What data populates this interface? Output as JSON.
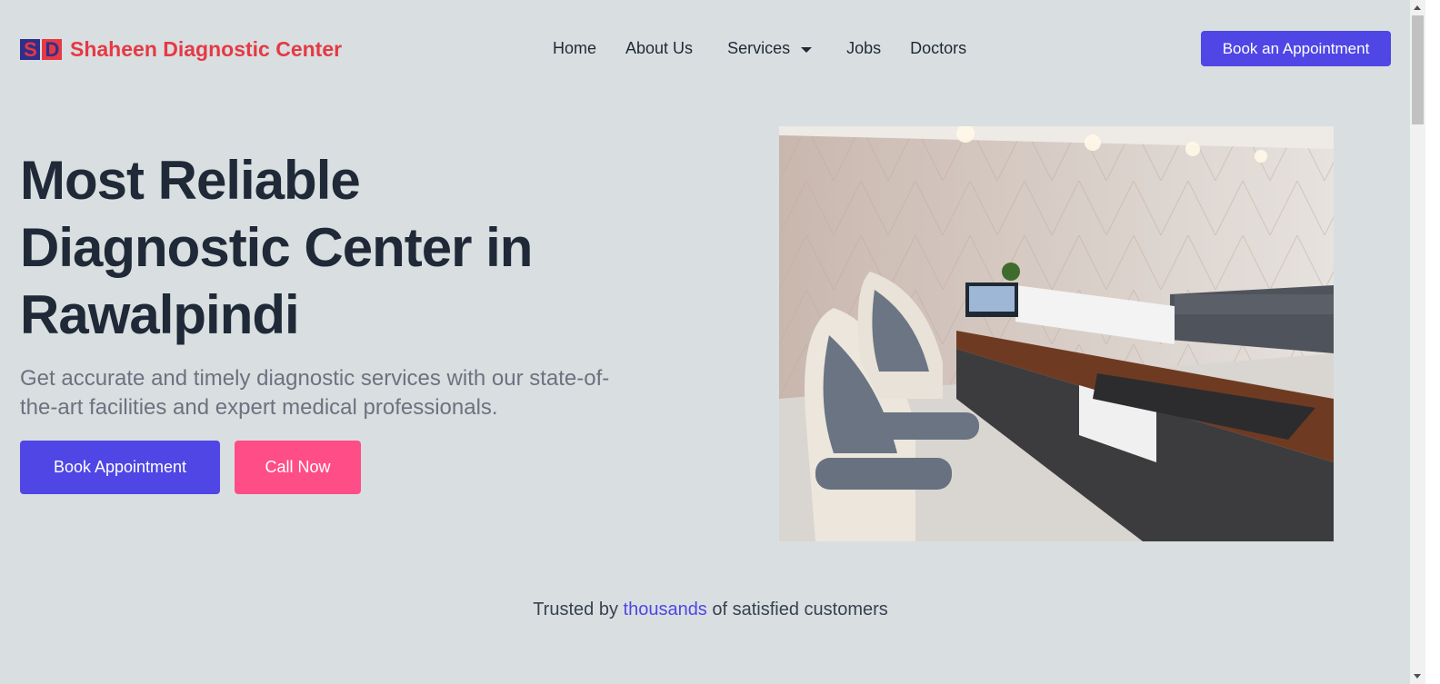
{
  "header": {
    "logo_mark": [
      "S",
      "D"
    ],
    "brand": "Shaheen Diagnostic Center",
    "nav": [
      {
        "label": "Home"
      },
      {
        "label": "About Us"
      },
      {
        "label": "Services",
        "dropdown": true
      },
      {
        "label": "Jobs"
      },
      {
        "label": "Doctors"
      }
    ],
    "cta": "Book an Appointment"
  },
  "hero": {
    "title": "Most Reliable Diagnostic Center in Rawalpindi",
    "subtitle": "Get accurate and timely diagnostic services with our state-of-the-art facilities and expert medical professionals.",
    "primary_button": "Book Appointment",
    "secondary_button": "Call Now"
  },
  "trust": {
    "prefix": "Trusted by",
    "highlight": "thousands",
    "suffix": "of satisfied customers"
  },
  "colors": {
    "brand": "#e53945",
    "primary": "#4f46e5",
    "secondary": "#ff4d88",
    "background": "#d9dfe0"
  }
}
